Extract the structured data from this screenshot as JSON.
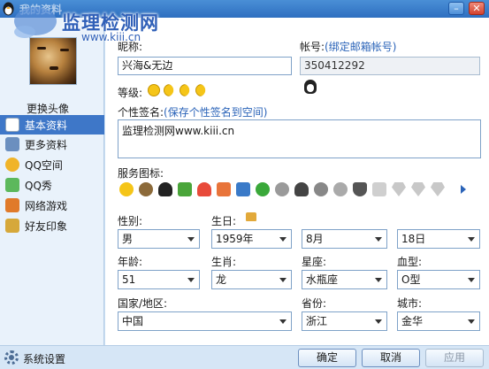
{
  "window": {
    "title": "我的资料"
  },
  "watermark": {
    "text": "监理检测网",
    "url": "www.kiii.cn"
  },
  "sidebar": {
    "change_avatar_label": "更换头像",
    "items": [
      {
        "label": "基本资料",
        "icon": "basic-info-icon",
        "color": "#4a86cf",
        "active": true
      },
      {
        "label": "更多资料",
        "icon": "more-info-icon",
        "color": "#6b8fbf"
      },
      {
        "label": "QQ空间",
        "icon": "qzone-icon",
        "color": "#f0b429"
      },
      {
        "label": "QQ秀",
        "icon": "qqshow-icon",
        "color": "#5cb85c"
      },
      {
        "label": "网络游戏",
        "icon": "games-icon",
        "color": "#e07a2a"
      },
      {
        "label": "好友印象",
        "icon": "impression-icon",
        "color": "#d6a83a"
      }
    ]
  },
  "profile": {
    "nickname_label": "昵称:",
    "nickname": "兴海&无边",
    "account_label": "帐号:",
    "account_link": "(绑定邮箱帐号)",
    "account": "350412292",
    "level_label": "等级:",
    "signature_label": "个性签名:",
    "signature_link": "(保存个性签名到空间)",
    "signature": "监理检测网www.kiii.cn",
    "services_label": "服务图标:"
  },
  "fields": {
    "gender": {
      "label": "性别:",
      "value": "男"
    },
    "birthday": {
      "label": "生日:",
      "year": "1959年",
      "month": "8月",
      "day": "18日"
    },
    "age": {
      "label": "年龄:",
      "value": "51"
    },
    "zodiac": {
      "label": "生肖:",
      "value": "龙"
    },
    "constellation": {
      "label": "星座:",
      "value": "水瓶座"
    },
    "blood": {
      "label": "血型:",
      "value": "O型"
    },
    "country": {
      "label": "国家/地区:",
      "value": "中国"
    },
    "province": {
      "label": "省份:",
      "value": "浙江"
    },
    "city": {
      "label": "城市:",
      "value": "金华"
    }
  },
  "footer": {
    "settings_label": "系统设置",
    "ok_label": "确定",
    "cancel_label": "取消",
    "apply_label": "应用"
  },
  "colors": {
    "accent": "#3e77c8",
    "link": "#2a63b8",
    "titlebar": "#2e6fc0"
  }
}
